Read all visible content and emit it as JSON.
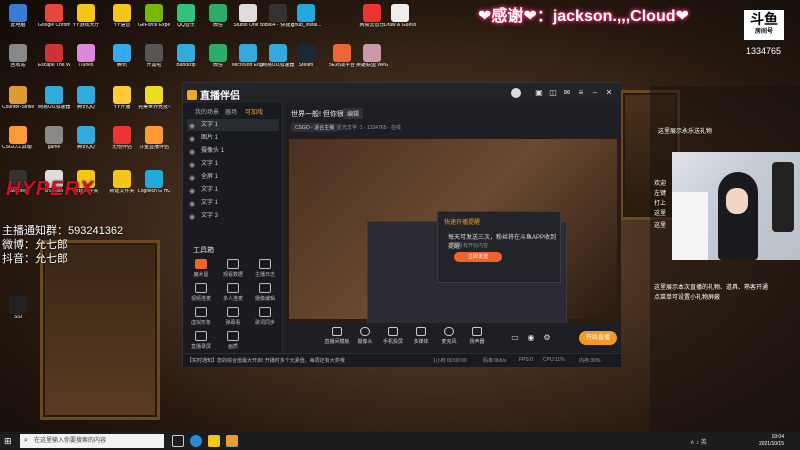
{
  "overlay": {
    "thanks_text": "❤感谢❤：jackson.,,,Cloud❤",
    "logo_text": "斗鱼",
    "logo_sub": "房间号",
    "room_id": "1334765",
    "hyperx": "HYPERX",
    "qq_group": "主播通知群：593241362",
    "weibo": "微博：允七郎",
    "douyin": "抖音：允七郎",
    "chat_items": [
      "这里展示本次直播的礼物、道具、熟客开通",
      "点菜单可设置小礼物屏蔽"
    ],
    "chat_header": "这里展示永乐送礼物",
    "chat_side_lines": [
      "欢迎",
      "左键",
      "打上",
      "这里",
      "这里"
    ]
  },
  "desktop_icons": [
    {
      "label": "此电脑",
      "color": "#3a7bd5"
    },
    {
      "label": "Google Chrome",
      "color": "#e8453c"
    },
    {
      "label": "YY游戏大厅",
      "color": "#f5c518"
    },
    {
      "label": "YY语音",
      "color": "#f5c518"
    },
    {
      "label": "GeForce Experience",
      "color": "#76b900"
    },
    {
      "label": "QQ音乐",
      "color": "#31c27c"
    },
    {
      "label": "微信",
      "color": "#2aae67"
    },
    {
      "label": "Studio One 5",
      "color": "#ddd"
    },
    {
      "label": "obs64 - 快捷方式",
      "color": "#333"
    },
    {
      "label": "lghub_instal...",
      "color": "#2ad"
    },
    {
      "label": "网易云音乐",
      "color": "#e33"
    },
    {
      "label": "Draw & Guess",
      "color": "#eee"
    },
    {
      "label": "回收站",
      "color": "#888"
    },
    {
      "label": "Escape The Wire Tour",
      "color": "#c33"
    },
    {
      "label": "iTunes",
      "color": "#d8d"
    },
    {
      "label": "腾讯",
      "color": "#3ae"
    },
    {
      "label": "开黑啦",
      "color": "#555"
    },
    {
      "label": "Bandizip",
      "color": "#3ad"
    },
    {
      "label": "微信",
      "color": "#2aae67"
    },
    {
      "label": "Microsoft Edge",
      "color": "#3ad"
    },
    {
      "label": "网易UU加速器",
      "color": "#3ad"
    },
    {
      "label": "Steam",
      "color": "#1b2838"
    },
    {
      "label": "5E对战平台",
      "color": "#e63"
    },
    {
      "label": "英雄联盟 WeGame版",
      "color": "#c9a"
    },
    {
      "label": "Counter-Strike Global Off...",
      "color": "#d93"
    },
    {
      "label": "网易UU加速器",
      "color": "#3ad"
    },
    {
      "label": "腾讯QQ",
      "color": "#3ad"
    },
    {
      "label": "YY开播",
      "color": "#fc3"
    },
    {
      "label": "完美世界竞技平台",
      "color": "#ed2"
    },
    {
      "label": "CSGO工具箱 1.0.3",
      "color": "#f93"
    },
    {
      "label": "game",
      "color": "#888"
    },
    {
      "label": "腾讯QQ",
      "color": "#3ad"
    },
    {
      "label": "无他伴侣",
      "color": "#e33"
    },
    {
      "label": "斗鱼直播伴侣",
      "color": "#f93"
    },
    {
      "label": "aweonly",
      "color": "#333"
    },
    {
      "label": "shaojian",
      "color": "#ddd"
    },
    {
      "label": "新建文件夹",
      "color": "#f5c518"
    },
    {
      "label": "新建文件夹",
      "color": "#f5c518"
    },
    {
      "label": "Logitech G HUB",
      "color": "#2ad"
    },
    {
      "label": "SSI",
      "color": "#222"
    }
  ],
  "app": {
    "logo": "直播伴侣",
    "tabs": [
      "我的场景",
      "器场",
      "可加戏"
    ],
    "scenes": [
      "文字 1",
      "图片 1",
      "摄像头 1",
      "文字 1",
      "全屏 1",
      "文字 1",
      "文字 1",
      "文字 3"
    ],
    "tools_title": "工具箱",
    "tools": [
      "魔术屋",
      "观看数据",
      "主播日志",
      "视频连麦",
      "多人连麦",
      "摄像编辑",
      "虚拟形象",
      "弹幕看",
      "歌词同步",
      "直播录屏",
      "画质"
    ],
    "room_title": "世界一般! 但你很强",
    "edit_label": "编辑",
    "game_tag": "CSGO - 适合主播",
    "room_info": "星光文字: 1 · 1334765 · 在线",
    "popup": {
      "title": "快速开播提醒",
      "text": "每天可发送三次，粉丝将在斗鱼APP收到提醒",
      "sub": "您还没有开始内容",
      "button": "立即发送"
    },
    "bottom_items": [
      "直播间模板",
      "摄像头",
      "手机投屏",
      "多媒体",
      "麦克风",
      "扬声器"
    ],
    "start_label": "开始直播",
    "status": {
      "notice": "【实时通知】您的综合值最大开启! 开播时多个元素值，每周还有大奖哦",
      "items": [
        "1小时 00:00:00",
        "码率:0kb/s",
        "FPS:0",
        "CPU:11%",
        "内存:30%"
      ]
    }
  },
  "taskbar": {
    "search_placeholder": "在这里输入你要搜索的内容",
    "time": "19:04",
    "date": "2021/10/15",
    "tray": "∧ ♪ 英"
  },
  "colors": {
    "accent": "#f39a2c",
    "thanks_glow": "#ff3070",
    "hyperx": "#d01020"
  }
}
